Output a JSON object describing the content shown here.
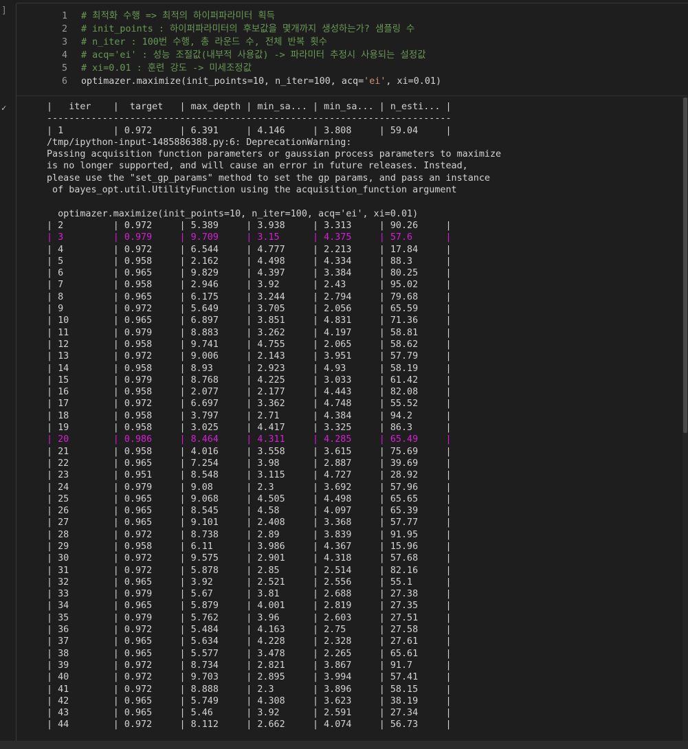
{
  "gutter": {
    "bracket": "]",
    "status_check": "✓"
  },
  "code": [
    {
      "n": "1",
      "text": "# 최적화 수행 => 최적의 하이퍼파라미터 획득"
    },
    {
      "n": "2",
      "text": "# init_points : 하이퍼파라미터의 후보값을 몇개까지 생성하는가? 샘플링 수"
    },
    {
      "n": "3",
      "text": "# n_iter : 100번 수행, 총 라운드 수, 전체 반복 횟수"
    },
    {
      "n": "4",
      "text": "# acq='ei' : 성능 조절값(내부적 사용값) -> 파라미터 추정시 사용되는 설정값"
    },
    {
      "n": "5",
      "text": "# xi=0.01 : 훈련 강도 -> 미세조정값"
    },
    {
      "n": "6",
      "pre": "optimazer.maximize(init_points=10, n_iter=100, acq=",
      "str": "'ei'",
      "post": ", xi=0.01)"
    }
  ],
  "table_header": "|   iter    |  target   | max_depth | min_sa... | min_sa... | n_esti... |",
  "table_rule": "-------------------------------------------------------------------------",
  "rows_before": [
    [
      "1",
      "0.972",
      "6.391",
      "4.146",
      "3.808",
      "59.04"
    ]
  ],
  "warning_lines": [
    "/tmp/ipython-input-1485886388.py:6: DeprecationWarning:",
    "Passing acquisition function parameters or gaussian process parameters to maximize",
    "is no longer supported, and will cause an error in future releases. Instead,",
    "please use the \"set_gp_params\" method to set the gp params, and pass an instance",
    " of bayes_opt.util.UtilityFunction using the acquisition_function argument",
    "",
    "  optimazer.maximize(init_points=10, n_iter=100, acq='ei', xi=0.01)"
  ],
  "rows_after": [
    [
      "2",
      "0.972",
      "5.389",
      "3.938",
      "3.313",
      "90.26"
    ],
    [
      "3",
      "0.979",
      "9.709",
      "3.15",
      "4.375",
      "57.6"
    ],
    [
      "4",
      "0.972",
      "6.544",
      "4.777",
      "2.213",
      "17.84"
    ],
    [
      "5",
      "0.958",
      "2.162",
      "4.498",
      "4.334",
      "88.3"
    ],
    [
      "6",
      "0.965",
      "9.829",
      "4.397",
      "3.384",
      "80.25"
    ],
    [
      "7",
      "0.958",
      "2.946",
      "3.92",
      "2.43",
      "95.02"
    ],
    [
      "8",
      "0.965",
      "6.175",
      "3.244",
      "2.794",
      "79.68"
    ],
    [
      "9",
      "0.972",
      "5.649",
      "3.705",
      "2.056",
      "65.59"
    ],
    [
      "10",
      "0.965",
      "6.897",
      "3.851",
      "4.831",
      "71.36"
    ],
    [
      "11",
      "0.979",
      "8.883",
      "3.262",
      "4.197",
      "58.81"
    ],
    [
      "12",
      "0.958",
      "9.741",
      "4.755",
      "2.065",
      "58.62"
    ],
    [
      "13",
      "0.972",
      "9.006",
      "2.143",
      "3.951",
      "57.79"
    ],
    [
      "14",
      "0.958",
      "8.93",
      "2.923",
      "4.93",
      "58.19"
    ],
    [
      "15",
      "0.979",
      "8.768",
      "4.225",
      "3.033",
      "61.42"
    ],
    [
      "16",
      "0.958",
      "2.077",
      "2.177",
      "4.443",
      "82.08"
    ],
    [
      "17",
      "0.972",
      "6.697",
      "3.362",
      "4.748",
      "55.52"
    ],
    [
      "18",
      "0.958",
      "3.797",
      "2.71",
      "4.384",
      "94.2"
    ],
    [
      "19",
      "0.958",
      "3.025",
      "4.417",
      "3.325",
      "86.3"
    ],
    [
      "20",
      "0.986",
      "8.464",
      "4.311",
      "4.285",
      "65.49"
    ],
    [
      "21",
      "0.958",
      "4.016",
      "3.558",
      "3.615",
      "75.69"
    ],
    [
      "22",
      "0.965",
      "7.254",
      "3.98",
      "2.887",
      "39.69"
    ],
    [
      "23",
      "0.951",
      "8.548",
      "3.115",
      "4.727",
      "28.92"
    ],
    [
      "24",
      "0.979",
      "9.08",
      "2.3",
      "3.692",
      "57.96"
    ],
    [
      "25",
      "0.965",
      "9.068",
      "4.505",
      "4.498",
      "65.65"
    ],
    [
      "26",
      "0.965",
      "8.545",
      "4.58",
      "4.097",
      "65.39"
    ],
    [
      "27",
      "0.965",
      "9.101",
      "2.408",
      "3.368",
      "57.77"
    ],
    [
      "28",
      "0.972",
      "8.738",
      "2.89",
      "3.839",
      "91.95"
    ],
    [
      "29",
      "0.958",
      "6.11",
      "3.986",
      "4.367",
      "15.96"
    ],
    [
      "30",
      "0.972",
      "9.575",
      "2.901",
      "4.318",
      "57.68"
    ],
    [
      "31",
      "0.972",
      "5.878",
      "2.85",
      "2.514",
      "82.16"
    ],
    [
      "32",
      "0.965",
      "3.92",
      "2.521",
      "2.556",
      "55.1"
    ],
    [
      "33",
      "0.979",
      "5.67",
      "3.81",
      "2.688",
      "27.38"
    ],
    [
      "34",
      "0.965",
      "5.879",
      "4.001",
      "2.819",
      "27.35"
    ],
    [
      "35",
      "0.979",
      "5.762",
      "3.96",
      "2.603",
      "27.51"
    ],
    [
      "36",
      "0.972",
      "5.484",
      "4.163",
      "2.75",
      "27.58"
    ],
    [
      "37",
      "0.965",
      "5.634",
      "4.228",
      "2.328",
      "27.61"
    ],
    [
      "38",
      "0.965",
      "5.577",
      "3.478",
      "2.265",
      "65.61"
    ],
    [
      "39",
      "0.972",
      "8.734",
      "2.821",
      "3.867",
      "91.7"
    ],
    [
      "40",
      "0.972",
      "9.703",
      "2.895",
      "3.994",
      "57.41"
    ],
    [
      "41",
      "0.972",
      "8.888",
      "2.3",
      "3.896",
      "58.15"
    ],
    [
      "42",
      "0.965",
      "5.749",
      "4.308",
      "3.623",
      "38.19"
    ],
    [
      "43",
      "0.965",
      "5.46",
      "3.92",
      "2.591",
      "27.34"
    ],
    [
      "44",
      "0.972",
      "8.112",
      "2.662",
      "4.074",
      "56.73"
    ]
  ],
  "highlighted_iters": [
    "3",
    "20"
  ],
  "colors": {
    "highlight": "#d61fd6",
    "comment": "#6a9955",
    "string": "#ce9178",
    "background": "#1e1e1e"
  }
}
